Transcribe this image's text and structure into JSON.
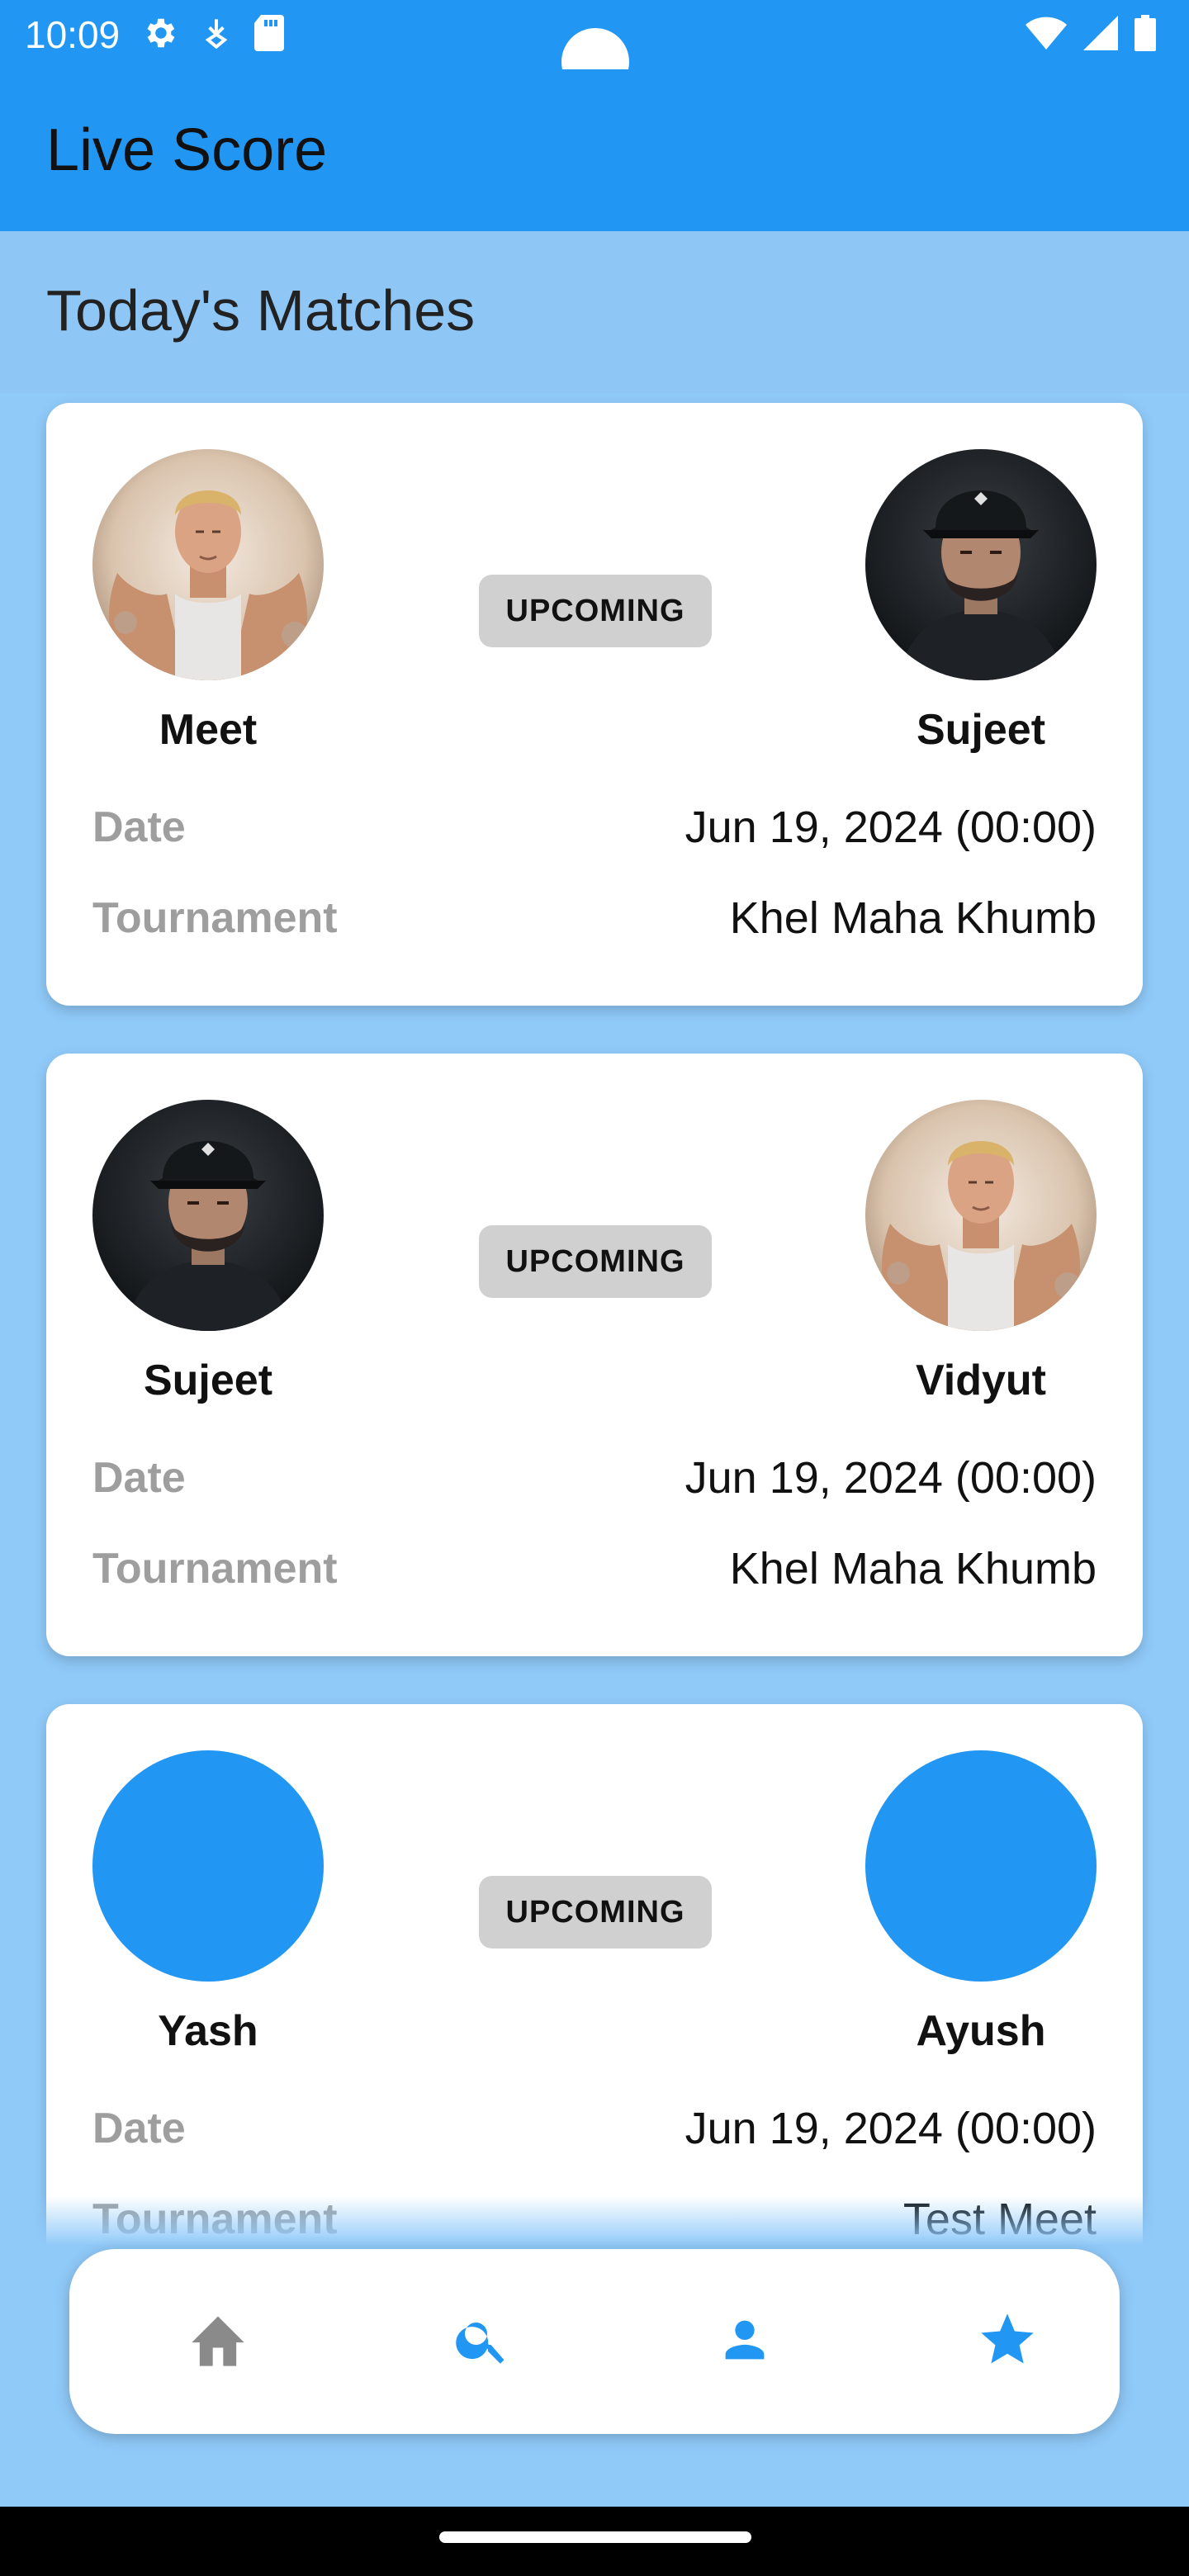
{
  "status_bar": {
    "time": "10:09",
    "left_icons": [
      "gear-icon",
      "network-icon",
      "sd-card-icon"
    ],
    "right_icons": [
      "wifi-icon",
      "signal-icon",
      "battery-icon"
    ]
  },
  "app_bar": {
    "title": "Live Score"
  },
  "section": {
    "title": "Today's Matches"
  },
  "labels": {
    "date": "Date",
    "tournament": "Tournament"
  },
  "matches": [
    {
      "player_left": {
        "name": "Meet",
        "avatar": "portrait-blond"
      },
      "player_right": {
        "name": "Sujeet",
        "avatar": "portrait-cap"
      },
      "status": "UPCOMING",
      "date": "Jun 19, 2024 (00:00)",
      "tournament": "Khel Maha Khumb"
    },
    {
      "player_left": {
        "name": "Sujeet",
        "avatar": "portrait-cap"
      },
      "player_right": {
        "name": "Vidyut",
        "avatar": "portrait-blond"
      },
      "status": "UPCOMING",
      "date": "Jun 19, 2024 (00:00)",
      "tournament": "Khel Maha Khumb"
    },
    {
      "player_left": {
        "name": "Yash",
        "avatar": "placeholder"
      },
      "player_right": {
        "name": "Ayush",
        "avatar": "placeholder"
      },
      "status": "UPCOMING",
      "date": "Jun 19, 2024 (00:00)",
      "tournament": "Test Meet"
    }
  ],
  "bottom_nav": [
    {
      "icon": "home-icon",
      "active": false
    },
    {
      "icon": "search-icon",
      "active": true
    },
    {
      "icon": "profile-icon",
      "active": true
    },
    {
      "icon": "star-icon",
      "active": true
    }
  ],
  "colors": {
    "primary": "#2196F3",
    "background": "#90CAF9",
    "badge": "#D0D0D0",
    "label_gray": "#9E9E9E",
    "nav_inactive": "#8A8A8A"
  }
}
